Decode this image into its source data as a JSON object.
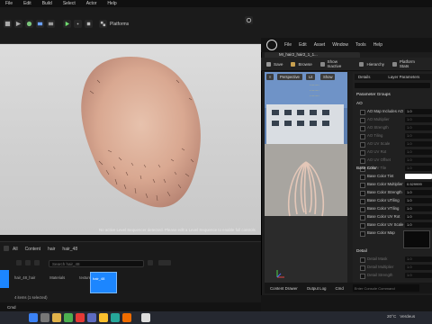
{
  "menubar": {
    "items": [
      "File",
      "Edit",
      "Build",
      "Select",
      "Actor",
      "Help"
    ]
  },
  "toolbar": {
    "platforms_label": "Platforms"
  },
  "viewport": {
    "message": "No active Level Sequencer detected. Please edit a Level Sequence to enable full controls"
  },
  "content_browser": {
    "breadcrumbs": [
      "All",
      "Content",
      "hair",
      "hair_48"
    ],
    "search_placeholder": "Search hair_48",
    "column_headers": [
      "hair_48_hair",
      "Materials",
      "textures"
    ],
    "selected_asset_label": "hair_48",
    "count": "4 items (1 selected)",
    "bottom_tabs": [
      "Cmd"
    ]
  },
  "material_editor": {
    "title_name": "M_hair2_hair2_1_1",
    "menu": [
      "File",
      "Edit",
      "Asset",
      "Window",
      "Tools",
      "Help"
    ],
    "toolbar": [
      "Save",
      "Browse",
      "Show Inactive",
      "Hierarchy",
      "Platform Stats"
    ],
    "tab_label": "MI_hair2_hair2_1_1...",
    "preview_buttons": [
      "Perspective",
      "Lit",
      "Show"
    ],
    "details_tab": "Details",
    "layer_tab": "Layer Parameters",
    "section_header": "Parameter Groups",
    "groups": {
      "ao": "AO",
      "base_color": "Base Color",
      "detail": "Detail"
    },
    "ao_rows": [
      {
        "k": "AO Map Includes AO",
        "v": "1.0",
        "dim": false
      },
      {
        "k": "AO Multiplier",
        "v": "1.0",
        "dim": true
      },
      {
        "k": "AO Strength",
        "v": "1.0",
        "dim": true
      },
      {
        "k": "AO Tiling",
        "v": "1.0",
        "dim": true
      },
      {
        "k": "AO UV Scale",
        "v": "1.0",
        "dim": true
      },
      {
        "k": "AO UV Rot",
        "v": "1.0",
        "dim": true
      },
      {
        "k": "AO UV Offset",
        "v": "1.0",
        "dim": true
      },
      {
        "k": "AO UV Tile",
        "v": "1.0",
        "dim": true
      }
    ],
    "base_rows": [
      {
        "k": "Base Color Tint",
        "v": "",
        "dim": false
      },
      {
        "k": "Base Color Multiplier",
        "v": "0.529999",
        "dim": false
      },
      {
        "k": "Base Color Strength",
        "v": "1.0",
        "dim": false
      },
      {
        "k": "Base Color UTiling",
        "v": "1.0",
        "dim": false
      },
      {
        "k": "Base Color VTiling",
        "v": "1.0",
        "dim": false
      },
      {
        "k": "Base Color UV Rot",
        "v": "1.0",
        "dim": false
      },
      {
        "k": "Base Color UV Scale",
        "v": "1.0",
        "dim": false
      },
      {
        "k": "Base Color Map",
        "v": "",
        "dim": false
      }
    ],
    "detail_rows": [
      {
        "k": "Detail Mask",
        "v": "1.0",
        "dim": true
      },
      {
        "k": "Detail Multiplier",
        "v": "1.0",
        "dim": true
      },
      {
        "k": "Detail Strength",
        "v": "1.0",
        "dim": true
      }
    ],
    "bottom": [
      "Content Drawer",
      "Output Log",
      "Cmd"
    ],
    "console_placeholder": "Enter Console Command"
  },
  "taskbar": {
    "weather": "20°C",
    "weather_desc": "Verdeus"
  },
  "colors": {
    "accent_blue": "#1c86ff",
    "preview_yellow": "#ffd23a"
  }
}
